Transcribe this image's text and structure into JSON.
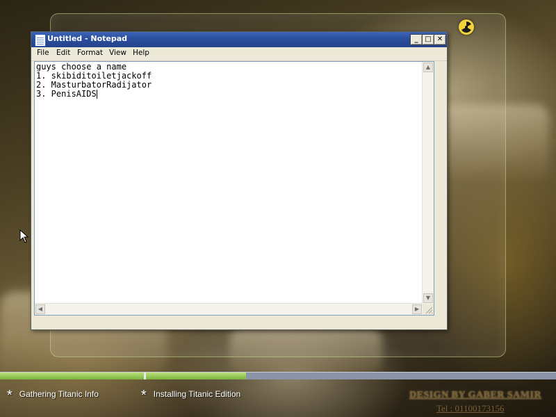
{
  "window": {
    "title": "Untitled - Notepad",
    "minimize": "_",
    "maximize": "□",
    "close": "✕"
  },
  "menu": {
    "items": [
      "File",
      "Edit",
      "Format",
      "View",
      "Help"
    ]
  },
  "editor": {
    "lines": [
      "guys choose a name",
      "1. skibiditoiletjackoff",
      "2. MasturbatorRadijator",
      "3. PenisAIDS"
    ]
  },
  "installer": {
    "progress_percent": 44,
    "steps": [
      {
        "label": "Gathering Titanic Info",
        "icon": "star-icon"
      },
      {
        "label": "Installing Titanic Edition",
        "icon": "star-icon"
      }
    ],
    "credit": "DESIGN BY GABER SAMIR",
    "phone": "Tel : 01100173156"
  },
  "colors": {
    "titlebar": "#2a4d9c",
    "progress_fill": "#7bb33e",
    "progress_track": "#8a94a6"
  }
}
